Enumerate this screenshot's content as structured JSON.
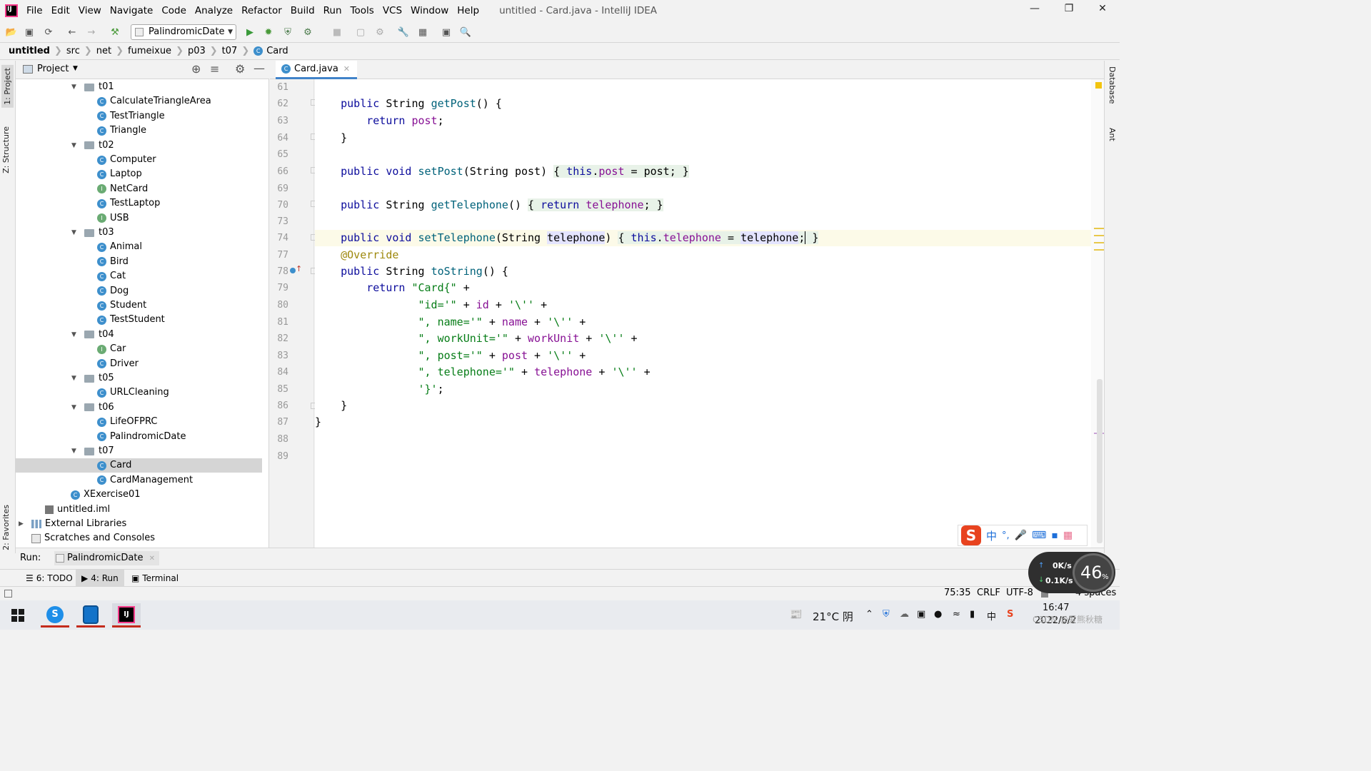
{
  "menubar": {
    "items": [
      "File",
      "Edit",
      "View",
      "Navigate",
      "Code",
      "Analyze",
      "Refactor",
      "Build",
      "Run",
      "Tools",
      "VCS",
      "Window",
      "Help"
    ],
    "title": "untitled - Card.java - IntelliJ IDEA"
  },
  "toolbar": {
    "run_config": "PalindromicDate"
  },
  "breadcrumb": [
    "untitled",
    "src",
    "net",
    "fumeixue",
    "p03",
    "t07",
    "Card"
  ],
  "left_tabs": {
    "project": "1: Project",
    "structure": "Z: Structure",
    "favorites": "2: Favorites"
  },
  "right_tabs": {
    "database": "Database",
    "ant": "Ant"
  },
  "project": {
    "header": "Project",
    "tree": [
      {
        "label": "t01",
        "type": "folder",
        "indent": 0
      },
      {
        "label": "CalculateTriangleArea",
        "type": "class",
        "indent": 1
      },
      {
        "label": "TestTriangle",
        "type": "class",
        "indent": 1
      },
      {
        "label": "Triangle",
        "type": "class",
        "indent": 1
      },
      {
        "label": "t02",
        "type": "folder",
        "indent": 0
      },
      {
        "label": "Computer",
        "type": "class",
        "indent": 1
      },
      {
        "label": "Laptop",
        "type": "class",
        "indent": 1
      },
      {
        "label": "NetCard",
        "type": "interface",
        "indent": 1
      },
      {
        "label": "TestLaptop",
        "type": "class",
        "indent": 1
      },
      {
        "label": "USB",
        "type": "interface",
        "indent": 1
      },
      {
        "label": "t03",
        "type": "folder",
        "indent": 0
      },
      {
        "label": "Animal",
        "type": "class",
        "indent": 1
      },
      {
        "label": "Bird",
        "type": "class",
        "indent": 1
      },
      {
        "label": "Cat",
        "type": "class",
        "indent": 1
      },
      {
        "label": "Dog",
        "type": "class",
        "indent": 1
      },
      {
        "label": "Student",
        "type": "class",
        "indent": 1
      },
      {
        "label": "TestStudent",
        "type": "class",
        "indent": 1
      },
      {
        "label": "t04",
        "type": "folder",
        "indent": 0
      },
      {
        "label": "Car",
        "type": "interface",
        "indent": 1
      },
      {
        "label": "Driver",
        "type": "class",
        "indent": 1
      },
      {
        "label": "t05",
        "type": "folder",
        "indent": 0
      },
      {
        "label": "URLCleaning",
        "type": "class",
        "indent": 1
      },
      {
        "label": "t06",
        "type": "folder",
        "indent": 0
      },
      {
        "label": "LifeOFPRC",
        "type": "class",
        "indent": 1
      },
      {
        "label": "PalindromicDate",
        "type": "class",
        "indent": 1
      },
      {
        "label": "t07",
        "type": "folder",
        "indent": 0
      },
      {
        "label": "Card",
        "type": "class",
        "indent": 1,
        "selected": true
      },
      {
        "label": "CardManagement",
        "type": "class",
        "indent": 1
      },
      {
        "label": "XExercise01",
        "type": "class",
        "indent": -1
      },
      {
        "label": "untitled.iml",
        "type": "module",
        "indent": -2
      },
      {
        "label": "External Libraries",
        "type": "library",
        "indent": -3
      },
      {
        "label": "Scratches and Consoles",
        "type": "scratch",
        "indent": -3
      }
    ]
  },
  "editor": {
    "tab": "Card.java",
    "line_numbers": [
      "61",
      "62",
      "63",
      "64",
      "65",
      "66",
      "69",
      "70",
      "73",
      "74",
      "77",
      "78",
      "79",
      "80",
      "81",
      "82",
      "83",
      "84",
      "85",
      "86",
      "87",
      "88",
      "89"
    ]
  },
  "run": {
    "label": "Run:",
    "tab": "PalindromicDate"
  },
  "bottom_tabs": {
    "todo": "6: TODO",
    "run": "4: Run",
    "terminal": "Terminal"
  },
  "status": {
    "position": "75:35",
    "line_sep": "CRLF",
    "encoding": "UTF-8",
    "indent": "4 spaces"
  },
  "ime": {
    "lang": "中"
  },
  "net_widget": {
    "up": "0K/s",
    "down": "0.1K/s",
    "percent": "46",
    "unit": "%"
  },
  "taskbar": {
    "weather": "21°C 阴",
    "time": "16:47",
    "date": "2022/6/2",
    "watermark": "CSDN @爱熊秋糖"
  },
  "colors": {
    "keyword": "#0c0c9c",
    "field": "#871094",
    "string": "#067d17",
    "annotation": "#9e880d",
    "accent": "#4083c9"
  }
}
